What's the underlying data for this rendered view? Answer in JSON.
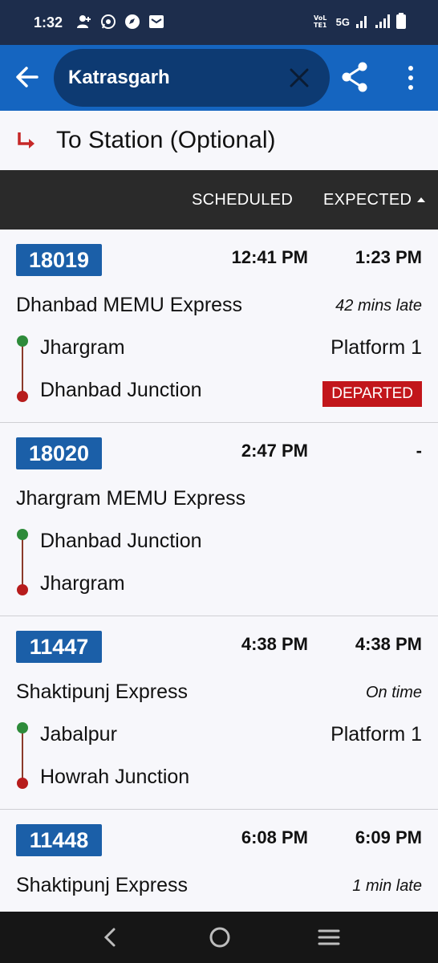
{
  "status_bar": {
    "time": "1:32",
    "network": "5G",
    "icons_left": [
      "person-add-icon",
      "whatsapp-icon",
      "compass-icon",
      "mail-icon"
    ],
    "icons_right": [
      "volte-icon",
      "5g-signal-icon",
      "signal-icon",
      "battery-icon"
    ]
  },
  "app_bar": {
    "search_value": "Katrasgarh",
    "icons": [
      "back-arrow-icon",
      "close-icon",
      "share-icon",
      "more-vert-icon"
    ]
  },
  "to_station": {
    "label": "To Station (Optional)"
  },
  "columns": {
    "scheduled": "SCHEDULED",
    "expected": "EXPECTED"
  },
  "trains": [
    {
      "number": "18019",
      "scheduled": "12:41 PM",
      "expected": "1:23 PM",
      "name": "Dhanbad MEMU Express",
      "delay": "42 mins late",
      "from": "Jhargram",
      "to": "Dhanbad Junction",
      "platform": "Platform 1",
      "status": "DEPARTED"
    },
    {
      "number": "18020",
      "scheduled": "2:47 PM",
      "expected": "-",
      "name": "Jhargram MEMU Express",
      "delay": "",
      "from": "Dhanbad Junction",
      "to": "Jhargram",
      "platform": "",
      "status": ""
    },
    {
      "number": "11447",
      "scheduled": "4:38 PM",
      "expected": "4:38 PM",
      "name": "Shaktipunj Express",
      "delay": "On time",
      "from": "Jabalpur",
      "to": "Howrah Junction",
      "platform": "Platform 1",
      "status": ""
    },
    {
      "number": "11448",
      "scheduled": "6:08 PM",
      "expected": "6:09 PM",
      "name": "Shaktipunj Express",
      "delay": "1 min late",
      "from": "",
      "to": "",
      "platform": "",
      "status": ""
    }
  ],
  "colors": {
    "app_bar": "#1565c0",
    "search_box": "#0d3a72",
    "status_bar": "#1d2d4c",
    "train_badge": "#1b5fa8",
    "departed_badge": "#c2161b",
    "origin_dot": "#2e8b3a",
    "destination_dot": "#b71c1c"
  },
  "nav_bar": {
    "icons": [
      "nav-back-icon",
      "nav-home-icon",
      "nav-recents-icon"
    ]
  }
}
